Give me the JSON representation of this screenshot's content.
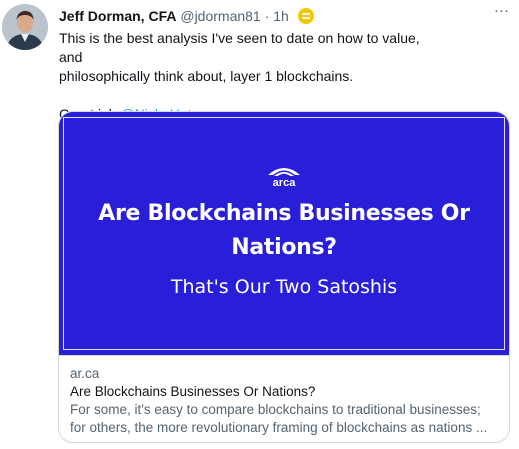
{
  "tweet": {
    "author_name": "Jeff Dorman, CFA",
    "handle": "@jdorman81",
    "separator": "·",
    "timestamp": "1h",
    "more_icon": "…",
    "text_line1": "This is the best analysis I've seen to date on how to value, and",
    "text_line2": "philosophically think about, layer 1 blockchains.",
    "text_line3_prefix": "Great job ",
    "mention": "@Nick_Hotz"
  },
  "card": {
    "image": {
      "logo_text": "arca",
      "headline_line1": "Are Blockchains Businesses Or",
      "headline_line2": "Nations?",
      "subheadline": "That's Our Two Satoshis"
    },
    "domain": "ar.ca",
    "title": "Are Blockchains Businesses Or Nations?",
    "description_line1": "For some, it's easy to compare blockchains to traditional businesses;",
    "description_line2": "for others, the more revolutionary framing of blockchains as nations ..."
  },
  "colors": {
    "card_background": "#2a1fd9",
    "link": "#1d9bf0",
    "badge": "#f7c400",
    "muted_text": "#536471"
  }
}
